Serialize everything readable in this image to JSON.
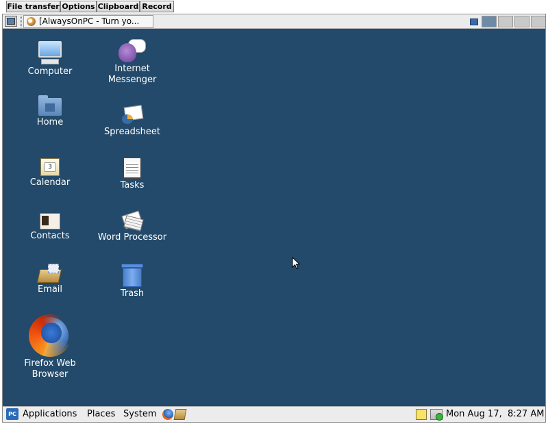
{
  "applet_toolbar": {
    "buttons": [
      "File transfer",
      "Options",
      "Clipboard",
      "Record"
    ]
  },
  "top_panel": {
    "task_button_label": "[AlwaysOnPC - Turn yo..."
  },
  "desktop": {
    "background_color": "#234a6a",
    "icons": [
      {
        "label": "Computer"
      },
      {
        "label": "Home"
      },
      {
        "label": "Calendar"
      },
      {
        "label": "Contacts"
      },
      {
        "label": "Email"
      },
      {
        "label": "Firefox Web Browser"
      },
      {
        "label": "Internet Messenger"
      },
      {
        "label": "Spreadsheet"
      },
      {
        "label": "Tasks"
      },
      {
        "label": "Word Processor"
      },
      {
        "label": "Trash"
      }
    ]
  },
  "bottom_panel": {
    "menu_logo_text": "PC",
    "menus": [
      "Applications",
      "Places",
      "System"
    ],
    "clock": "Mon Aug 17,  8:27 AM"
  }
}
